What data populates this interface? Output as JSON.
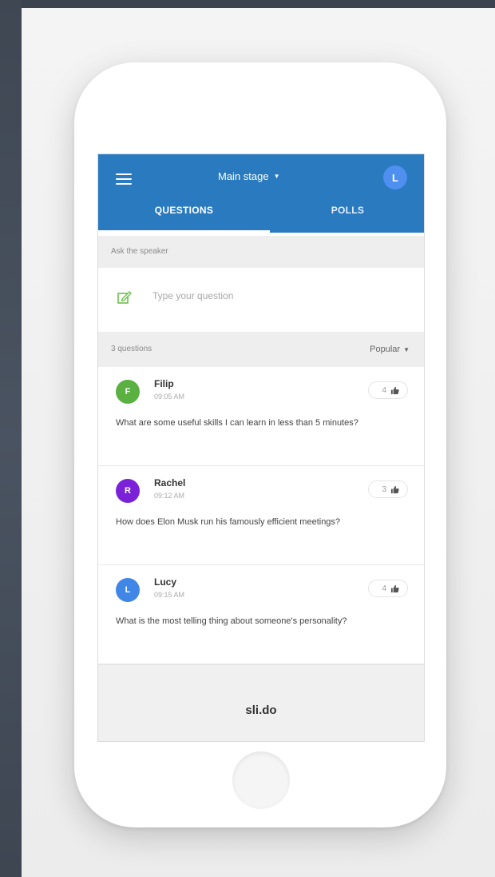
{
  "header": {
    "event_title": "Main stage",
    "user_initial": "L",
    "accent": "#2a7ac0"
  },
  "tabs": [
    {
      "label": "QUESTIONS",
      "active": true
    },
    {
      "label": "POLLS",
      "active": false
    }
  ],
  "ask": {
    "section_label": "Ask the speaker",
    "placeholder": "Type your question",
    "icon": "pencil-icon"
  },
  "list": {
    "count_label": "3 questions",
    "sort_label": "Popular"
  },
  "questions": [
    {
      "initial": "F",
      "name": "Filip",
      "time": "09:05 AM",
      "likes": "4",
      "text": "What are some useful skills I can learn in less than 5 minutes?",
      "color": "#5bb042"
    },
    {
      "initial": "R",
      "name": "Rachel",
      "time": "09:12 AM",
      "likes": "3",
      "text": "How does Elon Musk run his famously efficient meetings?",
      "color": "#7b22d8"
    },
    {
      "initial": "L",
      "name": "Lucy",
      "time": "09:15 AM",
      "likes": "4",
      "text": "What is the most telling thing about someone's personality?",
      "color": "#3f86e6"
    }
  ],
  "footer": {
    "brand": "sli.do"
  }
}
